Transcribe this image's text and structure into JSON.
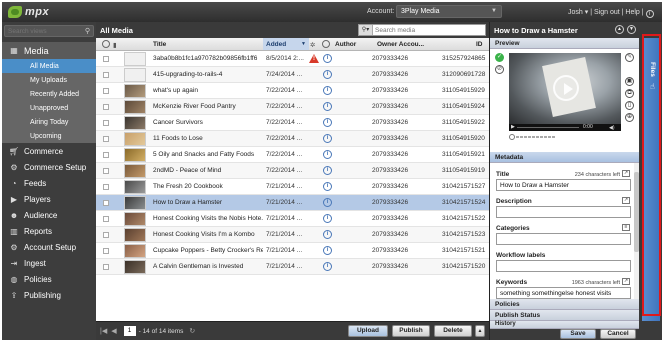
{
  "app": {
    "account_label": "Account:",
    "account_value": "3Play Media",
    "user": "Josh",
    "sign_out": "Sign out",
    "help": "Help",
    "separator": "|",
    "logo_text": "mpx"
  },
  "sidebar": {
    "search_placeholder": "Search views",
    "items": [
      {
        "label": "Media",
        "icon": "film-icon"
      },
      {
        "label": "Commerce",
        "icon": "cart-icon"
      },
      {
        "label": "Commerce Setup",
        "icon": "gear-icon"
      },
      {
        "label": "Feeds",
        "icon": "rss-icon"
      },
      {
        "label": "Players",
        "icon": "player-icon"
      },
      {
        "label": "Audience",
        "icon": "people-icon"
      },
      {
        "label": "Reports",
        "icon": "chart-icon"
      },
      {
        "label": "Account Setup",
        "icon": "gear-icon"
      },
      {
        "label": "Ingest",
        "icon": "ingest-icon"
      },
      {
        "label": "Policies",
        "icon": "globe-icon"
      },
      {
        "label": "Publishing",
        "icon": "publish-icon"
      }
    ],
    "media_subitems": [
      "All Media",
      "My Uploads",
      "Recently Added",
      "Unapproved",
      "Airing Today",
      "Upcoming"
    ]
  },
  "main": {
    "title": "All Media",
    "search_placeholder": "Search media",
    "columns": {
      "title": "Title",
      "added": "Added",
      "author": "Author",
      "owner": "Owner Accou...",
      "id": "ID"
    },
    "rows": [
      {
        "title": "3aba0b8b1fc1a970782b09856fb1ff6",
        "added": "8/5/2014 2:...",
        "owner": "2079333426",
        "id": "315257924865",
        "warn": true
      },
      {
        "title": "415-upgrading-to-rails-4",
        "added": "7/24/2014 ...",
        "owner": "2079333426",
        "id": "312090691728",
        "warn": false
      },
      {
        "title": "what's up again",
        "added": "7/22/2014 ...",
        "owner": "2079333426",
        "id": "311054915929",
        "warn": false
      },
      {
        "title": "McKenzie River Food Pantry",
        "added": "7/22/2014 ...",
        "owner": "2079333426",
        "id": "311054915924",
        "warn": false
      },
      {
        "title": "Cancer Survivors",
        "added": "7/22/2014 ...",
        "owner": "2079333426",
        "id": "311054915922",
        "warn": false
      },
      {
        "title": "11 Foods to Lose",
        "added": "7/22/2014 ...",
        "owner": "2079333426",
        "id": "311054915920",
        "warn": false
      },
      {
        "title": "5 Oily and Snacks and Fatty Foods",
        "added": "7/22/2014 ...",
        "owner": "2079333426",
        "id": "311054915921",
        "warn": false
      },
      {
        "title": "2ndMD - Peace of Mind",
        "added": "7/22/2014 ...",
        "owner": "2079333426",
        "id": "311054915919",
        "warn": false
      },
      {
        "title": "The Fresh 20 Cookbook",
        "added": "7/21/2014 ...",
        "owner": "2079333426",
        "id": "310421571527",
        "warn": false
      },
      {
        "title": "How to Draw a Hamster",
        "added": "7/21/2014 ...",
        "owner": "2079333426",
        "id": "310421571524",
        "warn": false,
        "selected": true
      },
      {
        "title": "Honest Cooking Visits the Nobis Hote...",
        "added": "7/21/2014 ...",
        "owner": "2079333426",
        "id": "310421571522",
        "warn": false
      },
      {
        "title": "Honest Cooking Visits I'm a Kombo",
        "added": "7/21/2014 ...",
        "owner": "2079333426",
        "id": "310421571523",
        "warn": false
      },
      {
        "title": "Cupcake Poppers - Betty Crocker's Re...",
        "added": "7/21/2014 ...",
        "owner": "2079333426",
        "id": "310421571521",
        "warn": false
      },
      {
        "title": "A Calvin Gentleman is Invested",
        "added": "7/21/2014 ...",
        "owner": "2079333426",
        "id": "310421571520",
        "warn": false
      }
    ],
    "pager": {
      "page": "1",
      "count": "- 14 of 14 items"
    },
    "buttons": {
      "upload": "Upload",
      "publish": "Publish",
      "delete": "Delete"
    }
  },
  "detail": {
    "title": "How to Draw a Hamster",
    "sections": {
      "preview": "Preview",
      "metadata": "Metadata",
      "policies": "Policies",
      "publish_status": "Publish Status",
      "history": "History"
    },
    "video": {
      "time": "0:00",
      "slider_position": 0
    },
    "fields": {
      "title_label": "Title",
      "title_note": "234 characters left",
      "title_value": "How to Draw a Hamster",
      "description_label": "Description",
      "description_value": "",
      "categories_label": "Categories",
      "categories_value": "",
      "workflow_label": "Workflow labels",
      "workflow_value": "",
      "keywords_label": "Keywords",
      "keywords_note": "1963 characters left",
      "keywords_value": "something somethingelse honest visits"
    },
    "buttons": {
      "save": "Save",
      "cancel": "Cancel"
    }
  },
  "files_tab": {
    "label": "Files"
  },
  "colors": {
    "accent": "#4a8ec8",
    "selected_row": "#b4c9e6",
    "highlight_frame": "#e0191b",
    "warning": "#d83a2a"
  }
}
